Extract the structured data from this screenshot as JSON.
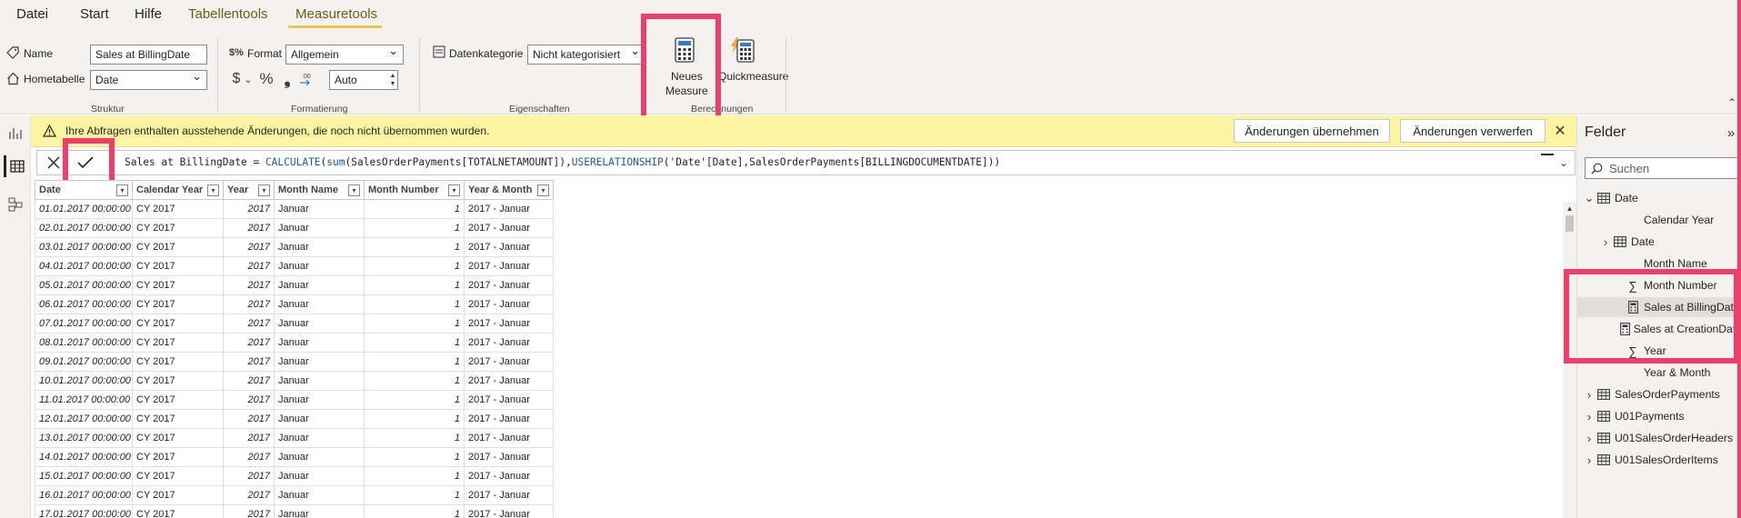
{
  "menu": {
    "tabs": [
      {
        "label": "Datei"
      },
      {
        "label": "Start"
      },
      {
        "label": "Hilfe"
      },
      {
        "label": "Tabellentools"
      },
      {
        "label": "Measuretools"
      }
    ]
  },
  "ribbon": {
    "struktur": {
      "name_label": "Name",
      "name_value": "Sales at BillingDate",
      "home_table_label": "Hometabelle",
      "home_table_value": "Date",
      "group_label": "Struktur"
    },
    "formatierung": {
      "format_label": "Format",
      "format_value": "Allgemein",
      "currency_symbol": "$",
      "percent_symbol": "%",
      "comma_symbol": "❟",
      "decimals_value": "Auto",
      "group_label": "Formatierung"
    },
    "eigenschaften": {
      "category_label": "Datenkategorie",
      "category_value": "Nicht kategorisiert",
      "group_label": "Eigenschaften"
    },
    "berechnungen": {
      "new_measure_label_line1": "Neues",
      "new_measure_label_line2": "Measure",
      "quick_measure_label": "Quickmeasure",
      "group_label": "Berechnungen"
    }
  },
  "notification": {
    "message": "Ihre Abfragen enthalten ausstehende Änderungen, die noch nicht übernommen wurden.",
    "apply_label": "Änderungen übernehmen",
    "discard_label": "Änderungen verwerfen"
  },
  "formula": {
    "measure_name": "Sales at BillingDate = ",
    "f1": "CALCULATE",
    "p1": "(",
    "f2": "sum",
    "p2": "(SalesOrderPayments[TOTALNETAMOUNT]),",
    "f3": "USERELATIONSHIP",
    "p3": "('Date'[Date],SalesOrderPayments[BILLINGDOCUMENTDATE]))"
  },
  "table": {
    "columns": [
      "Date",
      "Calendar Year",
      "Year",
      "Month Name",
      "Month Number",
      "Year & Month"
    ],
    "rows": [
      [
        "01.01.2017 00:00:00",
        "CY 2017",
        "2017",
        "Januar",
        "1",
        "2017 - Januar"
      ],
      [
        "02.01.2017 00:00:00",
        "CY 2017",
        "2017",
        "Januar",
        "1",
        "2017 - Januar"
      ],
      [
        "03.01.2017 00:00:00",
        "CY 2017",
        "2017",
        "Januar",
        "1",
        "2017 - Januar"
      ],
      [
        "04.01.2017 00:00:00",
        "CY 2017",
        "2017",
        "Januar",
        "1",
        "2017 - Januar"
      ],
      [
        "05.01.2017 00:00:00",
        "CY 2017",
        "2017",
        "Januar",
        "1",
        "2017 - Januar"
      ],
      [
        "06.01.2017 00:00:00",
        "CY 2017",
        "2017",
        "Januar",
        "1",
        "2017 - Januar"
      ],
      [
        "07.01.2017 00:00:00",
        "CY 2017",
        "2017",
        "Januar",
        "1",
        "2017 - Januar"
      ],
      [
        "08.01.2017 00:00:00",
        "CY 2017",
        "2017",
        "Januar",
        "1",
        "2017 - Januar"
      ],
      [
        "09.01.2017 00:00:00",
        "CY 2017",
        "2017",
        "Januar",
        "1",
        "2017 - Januar"
      ],
      [
        "10.01.2017 00:00:00",
        "CY 2017",
        "2017",
        "Januar",
        "1",
        "2017 - Januar"
      ],
      [
        "11.01.2017 00:00:00",
        "CY 2017",
        "2017",
        "Januar",
        "1",
        "2017 - Januar"
      ],
      [
        "12.01.2017 00:00:00",
        "CY 2017",
        "2017",
        "Januar",
        "1",
        "2017 - Januar"
      ],
      [
        "13.01.2017 00:00:00",
        "CY 2017",
        "2017",
        "Januar",
        "1",
        "2017 - Januar"
      ],
      [
        "14.01.2017 00:00:00",
        "CY 2017",
        "2017",
        "Januar",
        "1",
        "2017 - Januar"
      ],
      [
        "15.01.2017 00:00:00",
        "CY 2017",
        "2017",
        "Januar",
        "1",
        "2017 - Januar"
      ],
      [
        "16.01.2017 00:00:00",
        "CY 2017",
        "2017",
        "Januar",
        "1",
        "2017 - Januar"
      ],
      [
        "17.01.2017 00:00:00",
        "CY 2017",
        "2017",
        "Januar",
        "1",
        "2017 - Januar"
      ]
    ]
  },
  "fields": {
    "title": "Felder",
    "search_placeholder": "Suchen",
    "items": [
      {
        "label": "Date",
        "kind": "table-open"
      },
      {
        "label": "Calendar Year",
        "kind": "field"
      },
      {
        "label": "Date",
        "kind": "hierarchy"
      },
      {
        "label": "Month Name",
        "kind": "field"
      },
      {
        "label": "Month Number",
        "kind": "sigma"
      },
      {
        "label": "Sales at BillingDate",
        "kind": "measure"
      },
      {
        "label": "Sales at CreationDate",
        "kind": "measure"
      },
      {
        "label": "Year",
        "kind": "sigma"
      },
      {
        "label": "Year & Month",
        "kind": "field"
      },
      {
        "label": "SalesOrderPayments",
        "kind": "table"
      },
      {
        "label": "U01Payments",
        "kind": "table"
      },
      {
        "label": "U01SalesOrderHeaders",
        "kind": "table"
      },
      {
        "label": "U01SalesOrderItems",
        "kind": "table"
      }
    ]
  },
  "colors": {
    "accent_tab": "#e8c74a",
    "highlight": "#ef3e6a",
    "notification_bg": "#fdf4a2",
    "formula_keyword": "#1e59a8"
  }
}
